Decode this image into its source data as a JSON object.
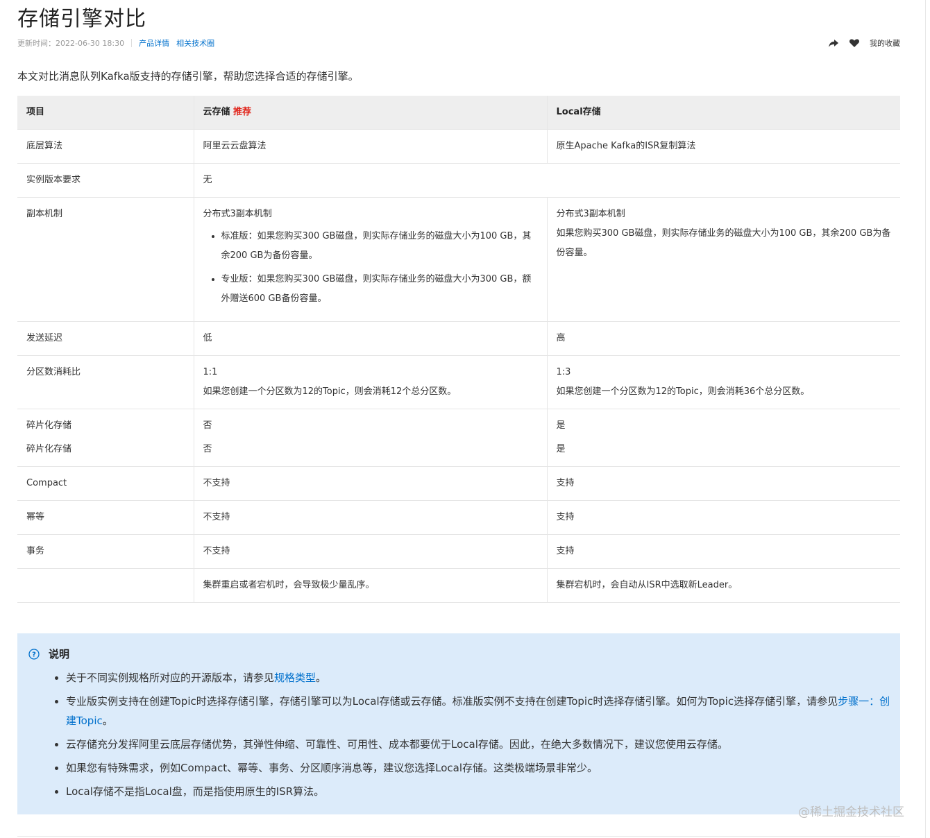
{
  "title": "存储引擎对比",
  "meta": {
    "updated": "更新时间：2022-06-30 18:30",
    "link1": "产品详情",
    "link2": "相关技术圈"
  },
  "actions": {
    "share_icon": "share-icon",
    "heart_icon": "heart-icon",
    "favorites": "我的收藏"
  },
  "intro": "本文对比消息队列Kafka版支持的存储引擎，帮助您选择合适的存储引擎。",
  "table": {
    "headers": [
      "项目",
      "云存储",
      "Local存储"
    ],
    "recommend_badge": "推荐",
    "rows": {
      "algo": {
        "label": "底层算法",
        "cloud": "阿里云云盘算法",
        "local": "原生Apache Kafka的ISR复制算法"
      },
      "version": {
        "label": "实例版本要求",
        "value": "无"
      },
      "replica": {
        "label": "副本机制",
        "cloud_title": "分布式3副本机制",
        "cloud_items": [
          "标准版：如果您购买300 GB磁盘，则实际存储业务的磁盘大小为100 GB，其余200 GB为备份容量。",
          "专业版：如果您购买300 GB磁盘，则实际存储业务的磁盘大小为300 GB，额外赠送600 GB备份容量。"
        ],
        "local_title": "分布式3副本机制",
        "local_text": "如果您购买300 GB磁盘，则实际存储业务的磁盘大小为100 GB，其余200 GB为备份容量。"
      },
      "latency": {
        "label": "发送延迟",
        "cloud": "低",
        "local": "高"
      },
      "partition": {
        "label": "分区数消耗比",
        "cloud_ratio": "1:1",
        "cloud_text": "如果您创建一个分区数为12的Topic，则会消耗12个总分区数。",
        "local_ratio": "1:3",
        "local_text": "如果您创建一个分区数为12的Topic，则会消耗36个总分区数。"
      },
      "fragment": {
        "label1": "碎片化存储",
        "label2": "碎片化存储",
        "cloud1": "否",
        "cloud2": "否",
        "local1": "是",
        "local2": "是"
      },
      "compact": {
        "label": "Compact",
        "cloud": "不支持",
        "local": "支持"
      },
      "idem": {
        "label": "幂等",
        "cloud": "不支持",
        "local": "支持"
      },
      "txn": {
        "label": "事务",
        "cloud": "不支持",
        "local": "支持"
      },
      "last": {
        "label": "",
        "cloud": "集群重启或者宕机时，会导致极少量乱序。",
        "local": "集群宕机时，会自动从ISR中选取新Leader。"
      }
    }
  },
  "note": {
    "icon": "question-circle-icon",
    "title": "说明",
    "item1_text": "关于不同实例规格所对应的开源版本，请参见",
    "item1_link": "规格类型",
    "item1_end": "。",
    "item2_text": "专业版实例支持在创建Topic时选择存储引擎，存储引擎可以为Local存储或云存储。标准版实例不支持在创建Topic时选择存储引擎。如何为Topic选择存储引擎，请参见",
    "item2_link": "步骤一：创建Topic",
    "item2_end": "。",
    "item3": "云存储充分发挥阿里云底层存储优势，其弹性伸缩、可靠性、可用性、成本都要优于Local存储。因此，在绝大多数情况下，建议您使用云存储。",
    "item4": "如果您有特殊需求，例如Compact、幂等、事务、分区顺序消息等，建议您选择Local存储。这类极端场景非常少。",
    "item5": "Local存储不是指Local盘，而是指使用原生的ISR算法。"
  },
  "watermark": "@稀土掘金技术社区",
  "colors": {
    "link": "#0070cc",
    "recommend": "#e1251b",
    "note_bg": "#dcebfa",
    "header_bg": "#eeeeee"
  }
}
